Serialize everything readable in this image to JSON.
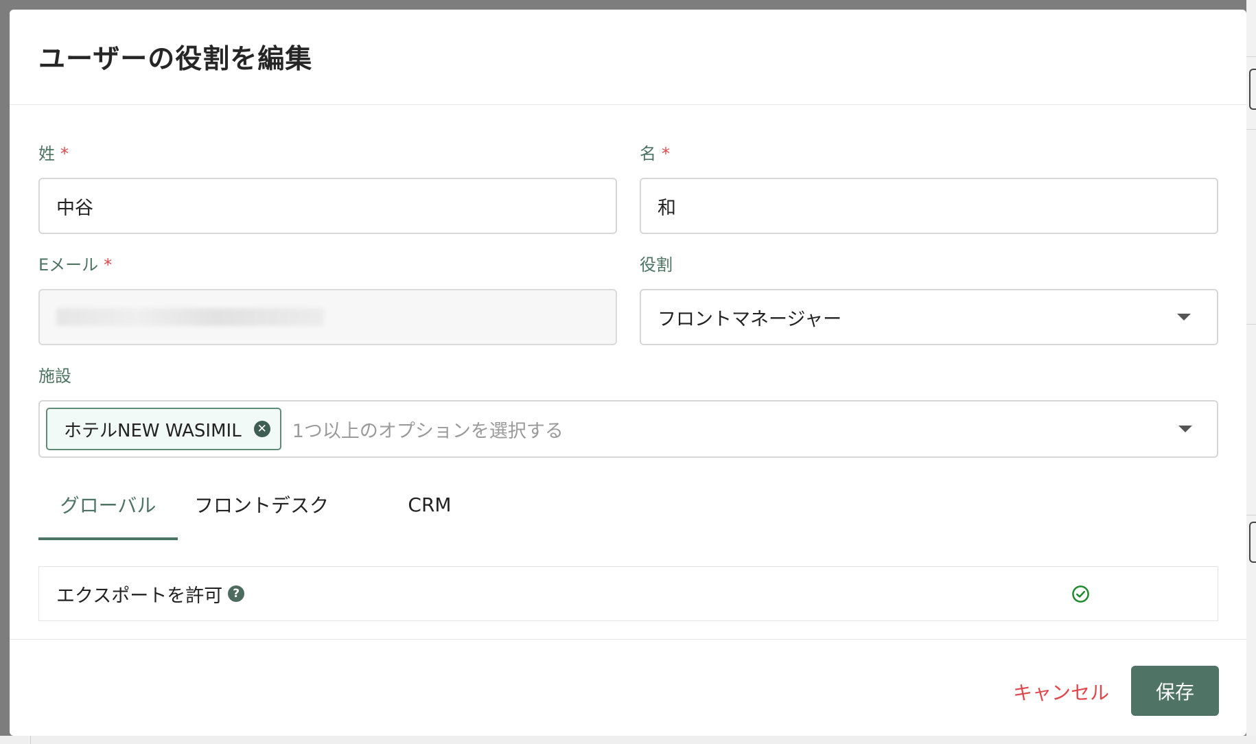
{
  "modal": {
    "title": "ユーザーの役割を編集"
  },
  "form": {
    "last_name": {
      "label": "姓",
      "required_mark": "*",
      "value": "中谷"
    },
    "first_name": {
      "label": "名",
      "required_mark": "*",
      "value": "和"
    },
    "email": {
      "label": "Eメール",
      "required_mark": "*",
      "value": "",
      "disabled": true
    },
    "role": {
      "label": "役割",
      "selected": "フロントマネージャー"
    },
    "facility": {
      "label": "施設",
      "selected_chips": [
        "ホテルNEW WASIMIL"
      ],
      "placeholder": "1つ以上のオプションを選択する"
    }
  },
  "tabs": [
    {
      "label": "グローバル",
      "active": true
    },
    {
      "label": "フロントデスク",
      "active": false
    },
    {
      "label": "CRM",
      "active": false
    }
  ],
  "permissions": [
    {
      "label": "エクスポートを許可",
      "enabled": true
    }
  ],
  "footer": {
    "cancel_label": "キャンセル",
    "save_label": "保存"
  },
  "colors": {
    "accent": "#4d7363",
    "danger": "#e0474c",
    "save_button": "#4f7466",
    "check": "#1f8a2e"
  },
  "icons": {
    "chip_remove": "close-circle-icon",
    "help": "question-circle-icon",
    "dropdown": "caret-down-icon",
    "permission_enabled": "check-circle-icon"
  }
}
